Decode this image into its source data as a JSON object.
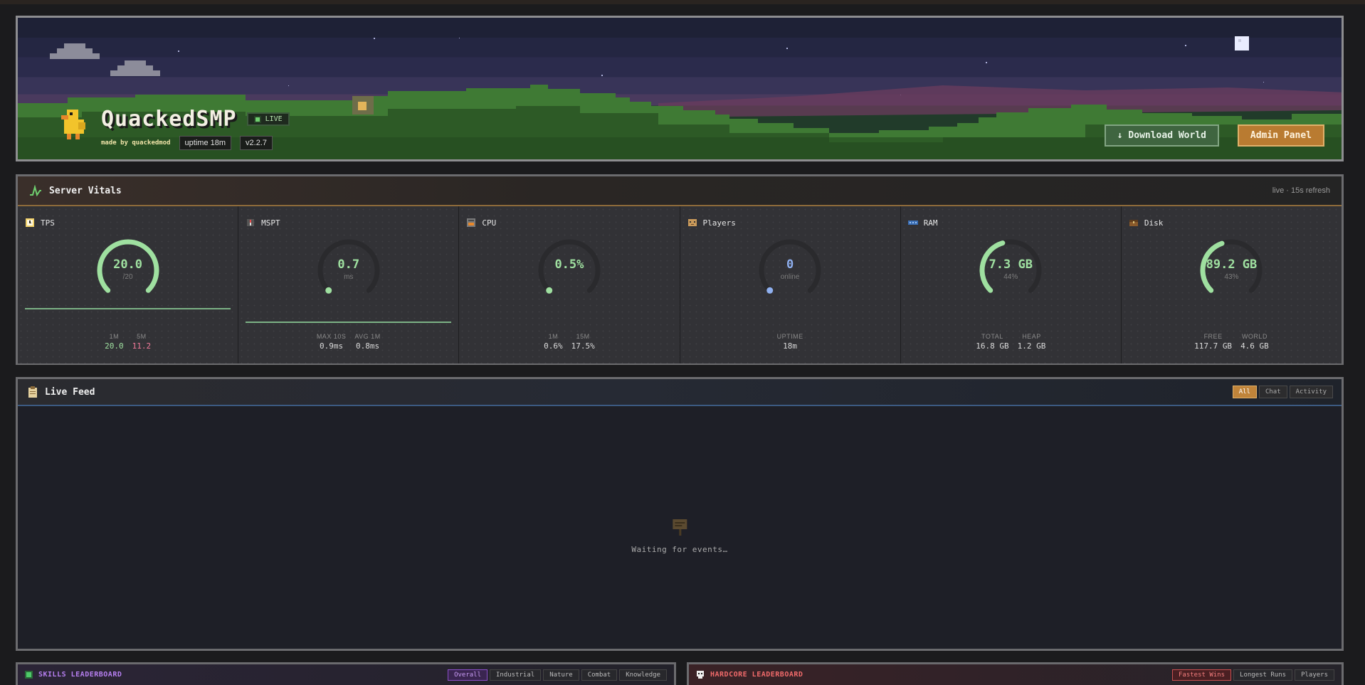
{
  "hero": {
    "title": "QuackedSMP",
    "live_label": "LIVE",
    "made_by": "made by quackedmod",
    "uptime_chip": "uptime 18m",
    "version_chip": "v2.2.7",
    "download_label": "↓ Download World",
    "admin_label": "Admin Panel"
  },
  "vitals": {
    "title": "Server Vitals",
    "subtitle": "live · 15s refresh",
    "cards": [
      {
        "label": "TPS",
        "icon": "clock-icon",
        "value": "20.0",
        "sub": "/20",
        "fill": 1.0,
        "color": "#9fe0a0",
        "stats": [
          {
            "k": "1M",
            "v": "20.0",
            "c": "#9fe0a0"
          },
          {
            "k": "5M",
            "v": "11.2",
            "c": "#f27a9a"
          }
        ]
      },
      {
        "label": "MSPT",
        "icon": "compass-icon",
        "value": "0.7",
        "sub": "ms",
        "fill": 0.0,
        "color": "#9fe0a0",
        "stats": [
          {
            "k": "MAX 10S",
            "v": "0.9ms",
            "c": "#dadada"
          },
          {
            "k": "AVG 1M",
            "v": "0.8ms",
            "c": "#dadada"
          }
        ]
      },
      {
        "label": "CPU",
        "icon": "furnace-icon",
        "value": "0.5%",
        "sub": "",
        "fill": 0.005,
        "color": "#9fe0a0",
        "stats": [
          {
            "k": "1M",
            "v": "0.6%",
            "c": "#dadada"
          },
          {
            "k": "15M",
            "v": "17.5%",
            "c": "#dadada"
          }
        ]
      },
      {
        "label": "Players",
        "icon": "player-head-icon",
        "value": "0",
        "sub": "online",
        "fill": 0.0,
        "color": "#8fb0f0",
        "stats": [
          {
            "k": "UPTIME",
            "v": "18m",
            "c": "#dadada"
          }
        ]
      },
      {
        "label": "RAM",
        "icon": "memory-icon",
        "value": "7.3 GB",
        "sub": "44%",
        "fill": 0.44,
        "color": "#9fe0a0",
        "stats": [
          {
            "k": "TOTAL",
            "v": "16.8 GB",
            "c": "#dadada"
          },
          {
            "k": "HEAP",
            "v": "1.2 GB",
            "c": "#dadada"
          }
        ]
      },
      {
        "label": "Disk",
        "icon": "chest-icon",
        "value": "89.2 GB",
        "sub": "43%",
        "fill": 0.43,
        "color": "#9fe0a0",
        "stats": [
          {
            "k": "FREE",
            "v": "117.7 GB",
            "c": "#dadada"
          },
          {
            "k": "WORLD",
            "v": "4.6 GB",
            "c": "#dadada"
          }
        ]
      }
    ]
  },
  "feed": {
    "title": "Live Feed",
    "tabs": [
      "All",
      "Chat",
      "Activity"
    ],
    "empty_text": "Waiting for events…"
  },
  "skills": {
    "title": "SKILLS LEADERBOARD",
    "tabs": [
      "Overall",
      "Industrial",
      "Nature",
      "Combat",
      "Knowledge"
    ]
  },
  "hardcore": {
    "title": "HARDCORE LEADERBOARD",
    "tabs": [
      "Fastest Wins",
      "Longest Runs",
      "Players"
    ]
  },
  "colors": {
    "accent_orange": "#c0843a",
    "good_green": "#9fe0a0",
    "warn_pink": "#f27a9a",
    "player_blue": "#8fb0f0"
  }
}
